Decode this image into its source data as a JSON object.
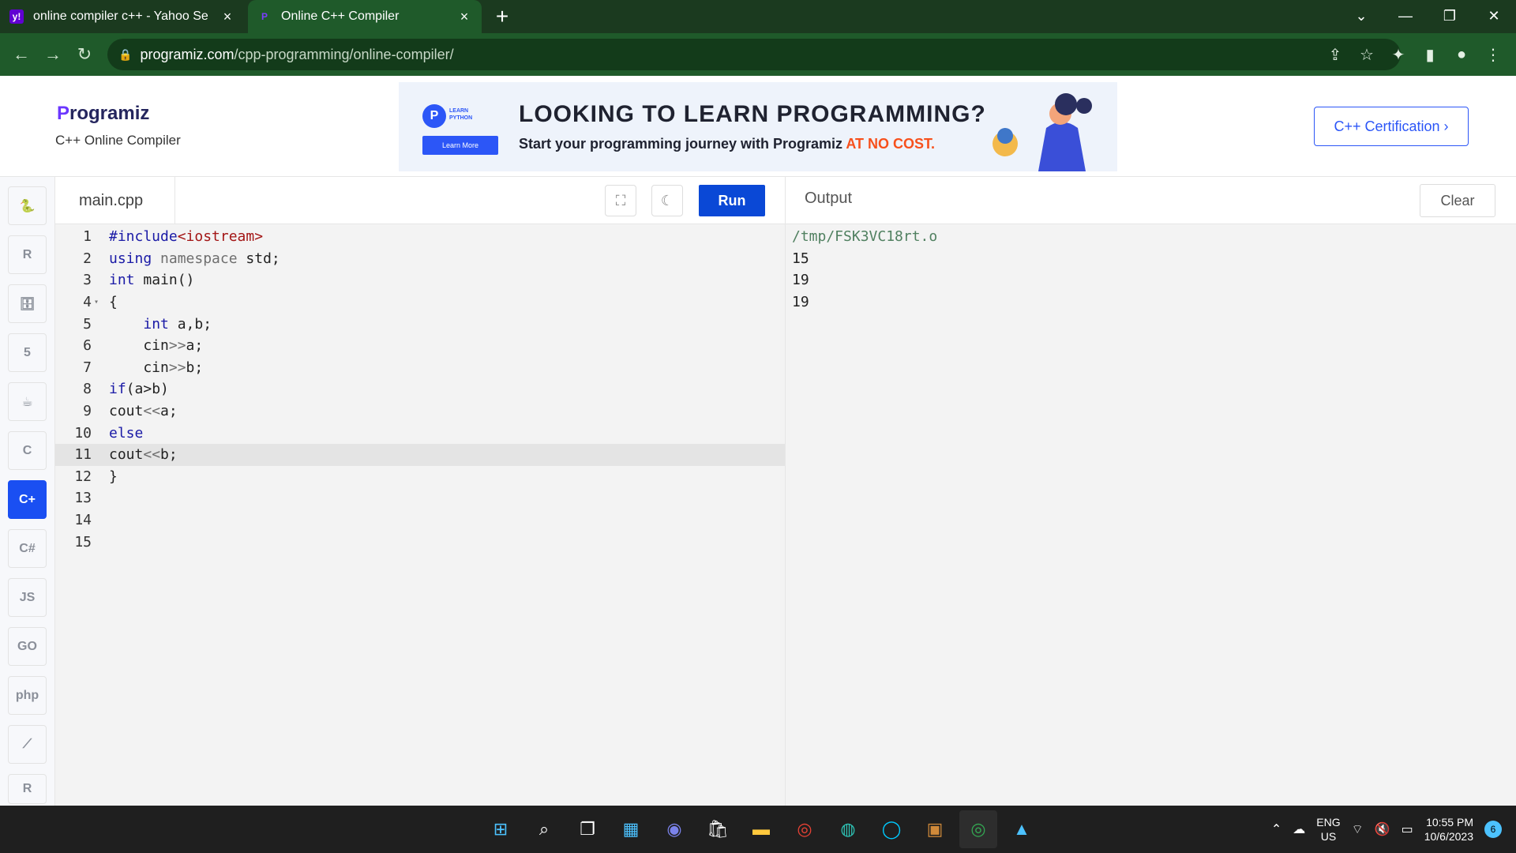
{
  "browser": {
    "tabs": [
      {
        "title": "online compiler c++ - Yahoo Se",
        "favicon": "yahoo-icon",
        "active": false
      },
      {
        "title": "Online C++ Compiler",
        "favicon": "programiz-icon",
        "active": true
      }
    ],
    "new_tab": "+",
    "url_host": "programiz.com",
    "url_path": "/cpp-programming/online-compiler/"
  },
  "site": {
    "logo_text": "rogramiz",
    "logo_letter": "P",
    "subtitle": "C++ Online Compiler",
    "cert_button": "C++ Certification ›"
  },
  "banner": {
    "badge_line1": "LEARN",
    "badge_line2": "PYTHON",
    "learn_more": "Learn More",
    "headline": "LOOKING TO LEARN PROGRAMMING?",
    "sub_main": "Start your programming journey with Programiz ",
    "sub_accent": "AT NO COST."
  },
  "sidebar": {
    "items": [
      {
        "name": "python",
        "label": "🐍",
        "active": false
      },
      {
        "name": "r",
        "label": "R",
        "active": false
      },
      {
        "name": "sql",
        "label": "🗄",
        "active": false
      },
      {
        "name": "html",
        "label": "5",
        "active": false
      },
      {
        "name": "java",
        "label": "☕",
        "active": false
      },
      {
        "name": "c",
        "label": "C",
        "active": false
      },
      {
        "name": "cpp",
        "label": "C+",
        "active": true
      },
      {
        "name": "csharp",
        "label": "C#",
        "active": false
      },
      {
        "name": "js",
        "label": "JS",
        "active": false
      },
      {
        "name": "go",
        "label": "GO",
        "active": false
      },
      {
        "name": "php",
        "label": "php",
        "active": false
      },
      {
        "name": "swift",
        "label": "⟋",
        "active": false
      },
      {
        "name": "rust",
        "label": "R",
        "active": false
      }
    ]
  },
  "editor": {
    "filename": "main.cpp",
    "run_label": "Run",
    "lines": [
      {
        "n": "1",
        "code": "#include<iostream>"
      },
      {
        "n": "2",
        "code": "using namespace std;"
      },
      {
        "n": "3",
        "code": "int main()"
      },
      {
        "n": "4",
        "code": "{"
      },
      {
        "n": "5",
        "code": "    int a,b;"
      },
      {
        "n": "6",
        "code": "    cin>>a;"
      },
      {
        "n": "7",
        "code": "    cin>>b;"
      },
      {
        "n": "8",
        "code": "if(a>b)"
      },
      {
        "n": "9",
        "code": "cout<<a;"
      },
      {
        "n": "10",
        "code": "else"
      },
      {
        "n": "11",
        "code": "cout<<b;"
      },
      {
        "n": "12",
        "code": "}"
      },
      {
        "n": "13",
        "code": ""
      },
      {
        "n": "14",
        "code": ""
      },
      {
        "n": "15",
        "code": ""
      }
    ]
  },
  "output": {
    "title": "Output",
    "clear_label": "Clear",
    "lines": [
      "/tmp/FSK3VC18rt.o",
      "15",
      "19",
      "19"
    ]
  },
  "taskbar": {
    "lang_top": "ENG",
    "lang_bottom": "US",
    "time": "10:55 PM",
    "date": "10/6/2023",
    "notifications": "6"
  },
  "colors": {
    "accent": "#1a4ff2",
    "run": "#0a48d6",
    "chrome_bg": "#1f5a2a"
  }
}
